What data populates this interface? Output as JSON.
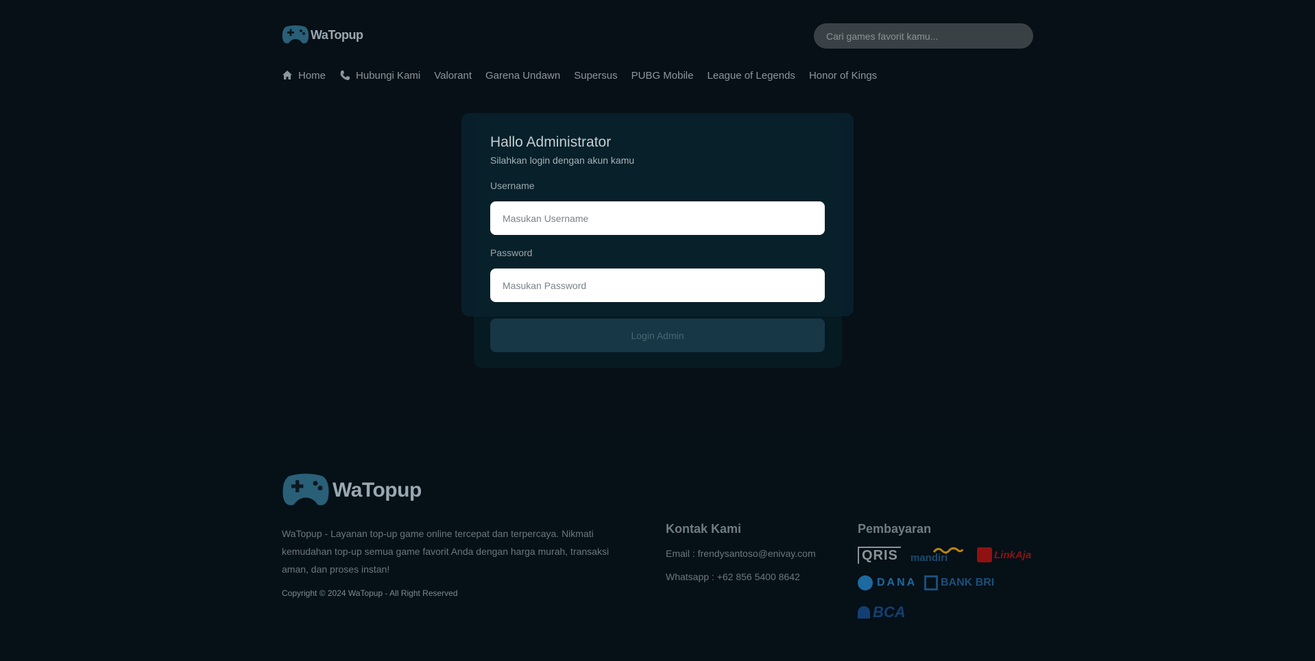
{
  "header": {
    "logo_text": "WaTopup",
    "search_placeholder": "Cari games favorit kamu..."
  },
  "nav": {
    "items": [
      {
        "label": "Home",
        "icon": "home-icon"
      },
      {
        "label": "Hubungi Kami",
        "icon": "phone-icon"
      },
      {
        "label": "Valorant"
      },
      {
        "label": "Garena Undawn"
      },
      {
        "label": "Supersus"
      },
      {
        "label": "PUBG Mobile"
      },
      {
        "label": "League of Legends"
      },
      {
        "label": "Honor of Kings"
      }
    ]
  },
  "login": {
    "title": "Hallo Administrator",
    "subtitle": "Silahkan login dengan akun kamu",
    "username_label": "Username",
    "username_placeholder": "Masukan Username",
    "password_label": "Password",
    "password_placeholder": "Masukan Password",
    "button_label": "Login Admin"
  },
  "footer": {
    "logo_text": "WaTopup",
    "about": "WaTopup - Layanan top-up game online tercepat dan terpercaya. Nikmati kemudahan top-up semua game favorit Anda dengan harga murah, transaksi aman, dan proses instan!",
    "copyright": "Copyright © 2024 WaTopup - All Right Reserved",
    "contact_title": "Kontak Kami",
    "email": "Email : frendysantoso@enivay.com",
    "whatsapp": "Whatsapp : +62 856 5400 8642",
    "payment_title": "Pembayaran",
    "payments": [
      {
        "label": "QRIS",
        "color": "#8a9398"
      },
      {
        "label": "mandiri",
        "color": "#1d4a6b"
      },
      {
        "label": "LinkAja",
        "color": "#8f1111"
      },
      {
        "label": "DANA",
        "color": "#1d6aa0"
      },
      {
        "label": "BANK BRI",
        "color": "#1b4e7a"
      },
      {
        "label": "BCA",
        "color": "#143f73"
      }
    ]
  },
  "colors": {
    "background": "#061016",
    "logo_accent": "#2a5f78",
    "card": "#072029",
    "button": "#173746"
  }
}
